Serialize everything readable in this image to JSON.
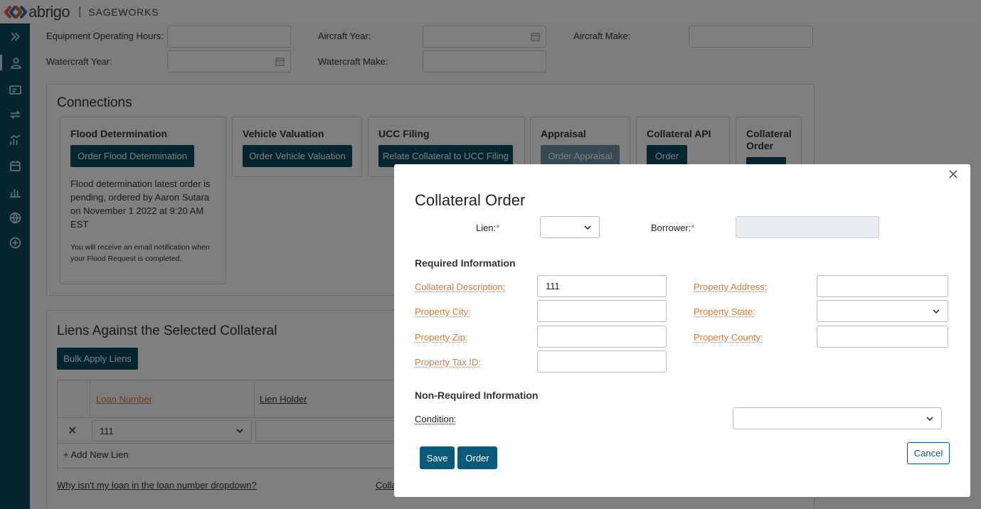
{
  "header": {
    "brand": "abrigo",
    "separator": "|",
    "product": "SAGEWORKS"
  },
  "sidebar": {
    "icons": [
      "expand-icon",
      "user-icon",
      "ticket-icon",
      "repeat-icon",
      "chart-people-icon",
      "calendar-icon",
      "bar-chart-icon",
      "globe-icon",
      "plus-circle-icon"
    ]
  },
  "fields": {
    "equipment_hours_label": "Equipment Operating Hours:",
    "aircraft_year_label": "Aircraft Year:",
    "aircraft_make_label": "Aircraft Make:",
    "watercraft_year_label": "Watercraft Year:",
    "watercraft_make_label": "Watercraft Make:"
  },
  "connections": {
    "title": "Connections",
    "flood": {
      "title": "Flood Determination",
      "button": "Order Flood Determination",
      "status": "Flood determination latest order is pending, ordered by Aaron Sutara on November 1 2022 at 9:20 AM EST",
      "note": "You will receive an email notification when your Flood Request is completed."
    },
    "vehicle": {
      "title": "Vehicle Valuation",
      "button": "Order Vehicle Valuation"
    },
    "ucc": {
      "title": "UCC Filing",
      "button": "Relate Collateral to UCC Filing"
    },
    "appraisal": {
      "title": "Appraisal",
      "button": "Order Appraisal"
    },
    "api": {
      "title": "Collateral API",
      "button": "Order"
    },
    "order": {
      "title": "Collateral Order"
    }
  },
  "liens": {
    "title": "Liens Against the Selected Collateral",
    "bulk_button": "Bulk Apply Liens",
    "columns": [
      "Loan Number",
      "Lien Holder"
    ],
    "row_loan": "111",
    "add_new": "+ Add New Lien",
    "help_link": "Why isn't my loan in the loan number dropdown?",
    "partial_link": "Colla"
  },
  "modal": {
    "title": "Collateral Order",
    "lien_label": "Lien:",
    "borrower_label": "Borrower:",
    "required_star": "*",
    "required_section": "Required Information",
    "collateral_description_label": "Collateral Description:",
    "collateral_description_value": "111",
    "property_address_label": "Property Address:",
    "property_city_label": "Property City:",
    "property_state_label": "Property State:",
    "property_zip_label": "Property Zip:",
    "property_county_label": "Property County:",
    "property_tax_id_label": "Property Tax ID:",
    "non_required_section": "Non-Required Information",
    "condition_label": "Condition:",
    "save_label": "Save",
    "order_label": "Order",
    "cancel_label": "Cancel"
  },
  "colors": {
    "sidebar": "#0b4a63",
    "primary_button": "#0b5a7a",
    "required_label": "#e07b39",
    "required_star": "#d9534f"
  }
}
